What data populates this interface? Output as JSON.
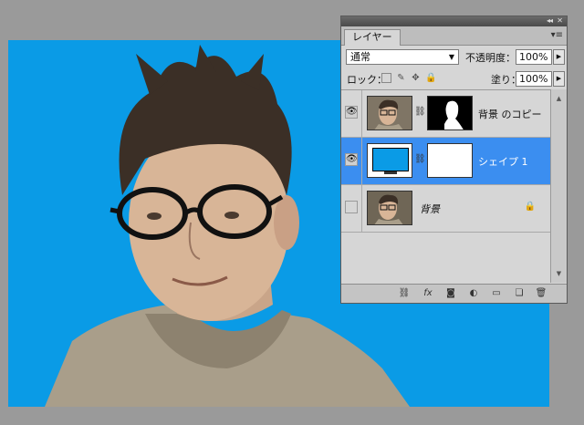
{
  "canvas": {
    "background_color": "#0a9be6"
  },
  "panel": {
    "collapse_icon": "double-chevron-right-icon",
    "close_icon": "close-icon",
    "tab_label": "レイヤー",
    "menu_icon": "panel-menu-icon",
    "blend_mode": "通常",
    "opacity_label": "不透明度：",
    "opacity_value": "100%",
    "lock_label": "ロック：",
    "fill_label": "塗り：",
    "fill_value": "100%",
    "layers": [
      {
        "name": "背景 のコピー",
        "visible": true,
        "selected": false,
        "has_mask": true
      },
      {
        "name": "シェイプ 1",
        "visible": true,
        "selected": true,
        "has_mask": true,
        "fill_color": "#0a9be6"
      },
      {
        "name": "背景",
        "visible": false,
        "selected": false,
        "locked": true,
        "italic": true
      }
    ],
    "footer_icons": [
      "link-icon",
      "fx-icon",
      "add-mask-icon",
      "adjustment-layer-icon",
      "new-group-icon",
      "new-layer-icon",
      "trash-icon"
    ],
    "selection_color": "#3b8ef0"
  }
}
